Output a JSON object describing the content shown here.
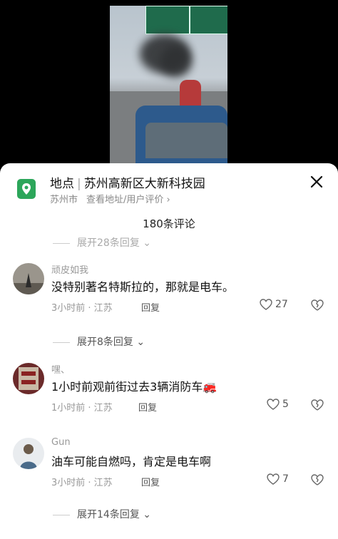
{
  "location": {
    "label": "地点",
    "name": "苏州高新区大新科技园",
    "city": "苏州市",
    "sub_link": "查看地址/用户评价 ›",
    "icon": "location-pin-icon",
    "accent": "#2ca65a"
  },
  "comment_count": "180条评论",
  "expand_top": "展开28条回复 ⌄",
  "comments": [
    {
      "user": "顽皮如我",
      "text": "没特别著名特斯拉的，那就是电车。",
      "time": "3小时前 · 江苏",
      "reply": "回复",
      "likes": "27",
      "expand": "展开8条回复"
    },
    {
      "user": "嘿、",
      "text": "1小时前观前街过去3辆消防车🚒",
      "time": "1小时前 · 江苏",
      "reply": "回复",
      "likes": "5"
    },
    {
      "user": "Gun",
      "text": "油车可能自燃吗，肯定是电车啊",
      "time": "3小时前 · 江苏",
      "reply": "回复",
      "likes": "7",
      "expand": "展开14条回复"
    }
  ]
}
